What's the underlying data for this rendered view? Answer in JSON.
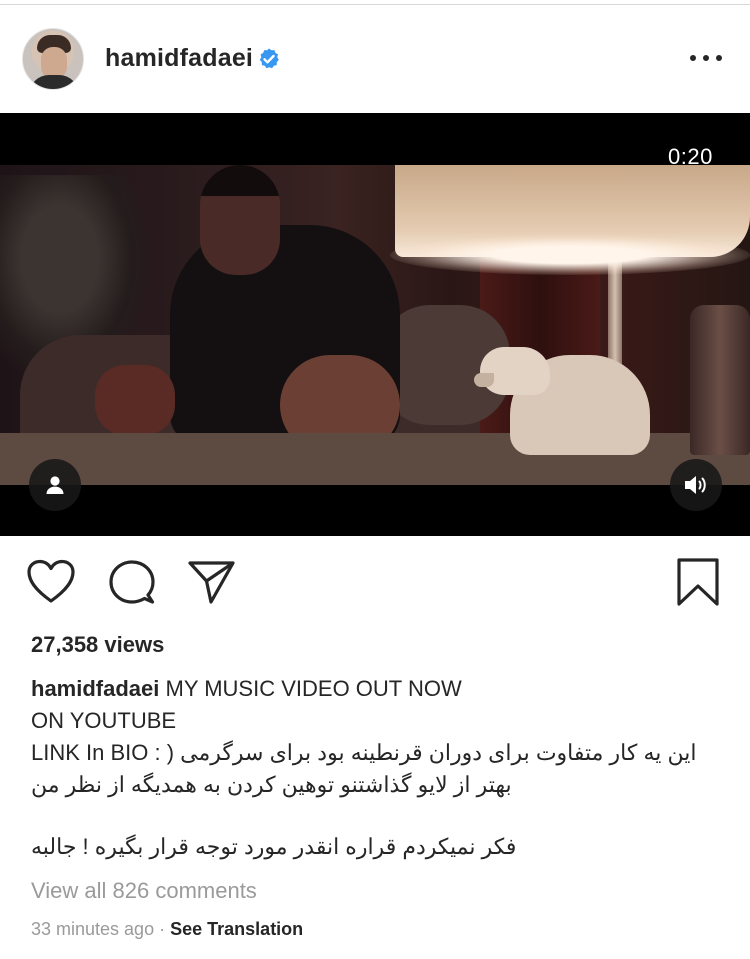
{
  "post": {
    "username": "hamidfadaei",
    "verified": true,
    "more_icon": "more-horizontal-icon"
  },
  "video": {
    "timer": "0:20",
    "user_tag_icon": "person-icon",
    "sound_icon": "speaker-icon"
  },
  "actions": {
    "like_icon": "heart-icon",
    "comment_icon": "comment-bubble-icon",
    "share_icon": "paper-plane-icon",
    "save_icon": "bookmark-icon"
  },
  "stats": {
    "views": "27,358 views"
  },
  "caption": {
    "username": "hamidfadaei",
    "line1": "MY MUSIC VIDEO OUT NOW",
    "line2": "ON YOUTUBE",
    "line3": "این یه کار متفاوت برای دوران قرنطینه بود برای سرگرمی  ( : LINK In BIO",
    "line4": "بهتر از لایو گذاشتنو توهین کردن به همدیگه از نظر من",
    "line5": "فکر نمیکردم قراره انقدر مورد توجه قرار بگیره ! جالبه"
  },
  "comments": {
    "view_all": "View all 826 comments"
  },
  "footer": {
    "time": "33 minutes ago",
    "separator": "·",
    "translate": "See Translation"
  },
  "colors": {
    "text": "#262626",
    "muted": "#9a9a9a",
    "verified_blue": "#3897f0",
    "background": "#ffffff"
  }
}
